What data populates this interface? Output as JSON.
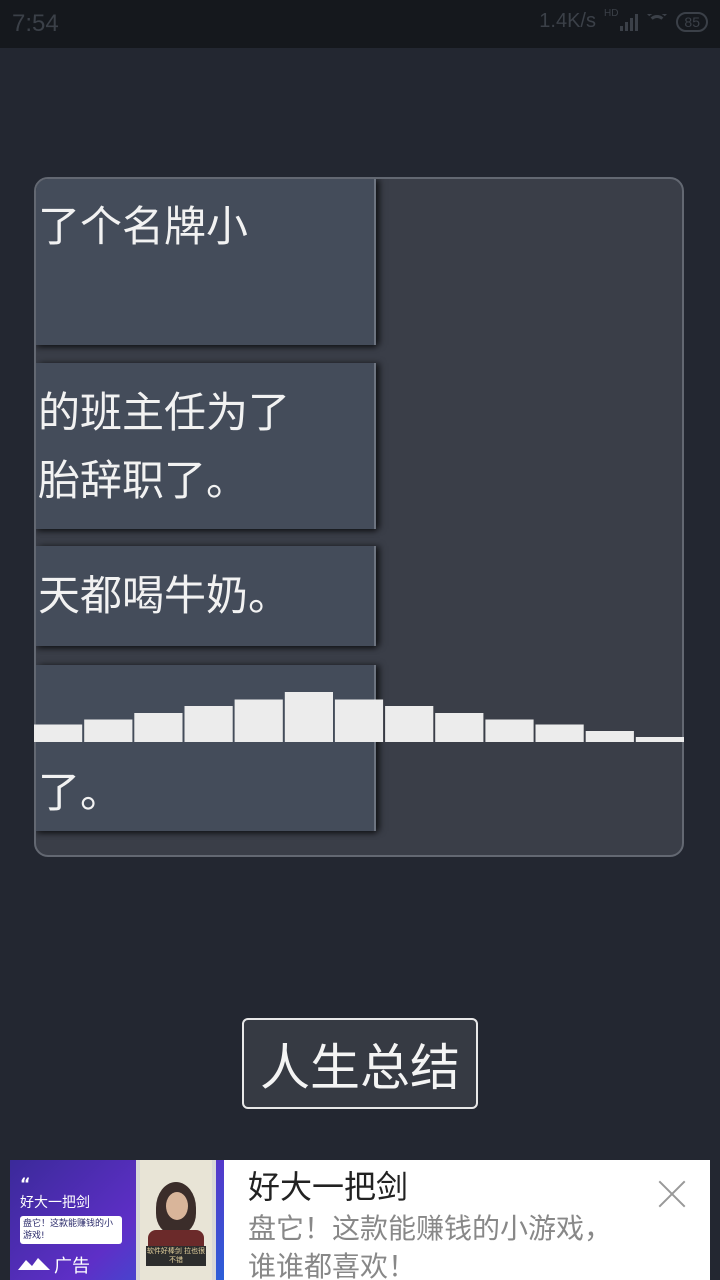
{
  "status_bar": {
    "time": "7:54",
    "network_speed": "1.4K/s",
    "network_type": "HD",
    "battery": "85",
    "icons": [
      "signal-icon",
      "wifi-icon",
      "battery-icon"
    ]
  },
  "event_cards": [
    {
      "text": "了个名牌小"
    },
    {
      "text": "的班主任为了\n胎辞职了。"
    },
    {
      "text": "天都喝牛奶。"
    },
    {
      "text": "了。"
    }
  ],
  "visualizer": {
    "levels": [
      0.35,
      0.45,
      0.58,
      0.72,
      0.85,
      1.0,
      0.85,
      0.72,
      0.58,
      0.45,
      0.35,
      0.22,
      0.1
    ],
    "color": "#ececec"
  },
  "summary_button": {
    "label": "人生总结"
  },
  "ad": {
    "thumb_quote": "“",
    "thumb_title": "好大一把剑",
    "thumb_sub": "盘它！这款能赚钱的小游戏!",
    "thumb_tag": "广告",
    "thumb_caption": "软件好棒剑 拉也很不错",
    "title": "好大一把剑",
    "description": "盘它！这款能赚钱的小游戏，谁谁都喜欢！"
  },
  "colors": {
    "background": "#232731",
    "panel": "#3a3e48",
    "card": "#444c5a",
    "text": "#f2f2f2"
  }
}
